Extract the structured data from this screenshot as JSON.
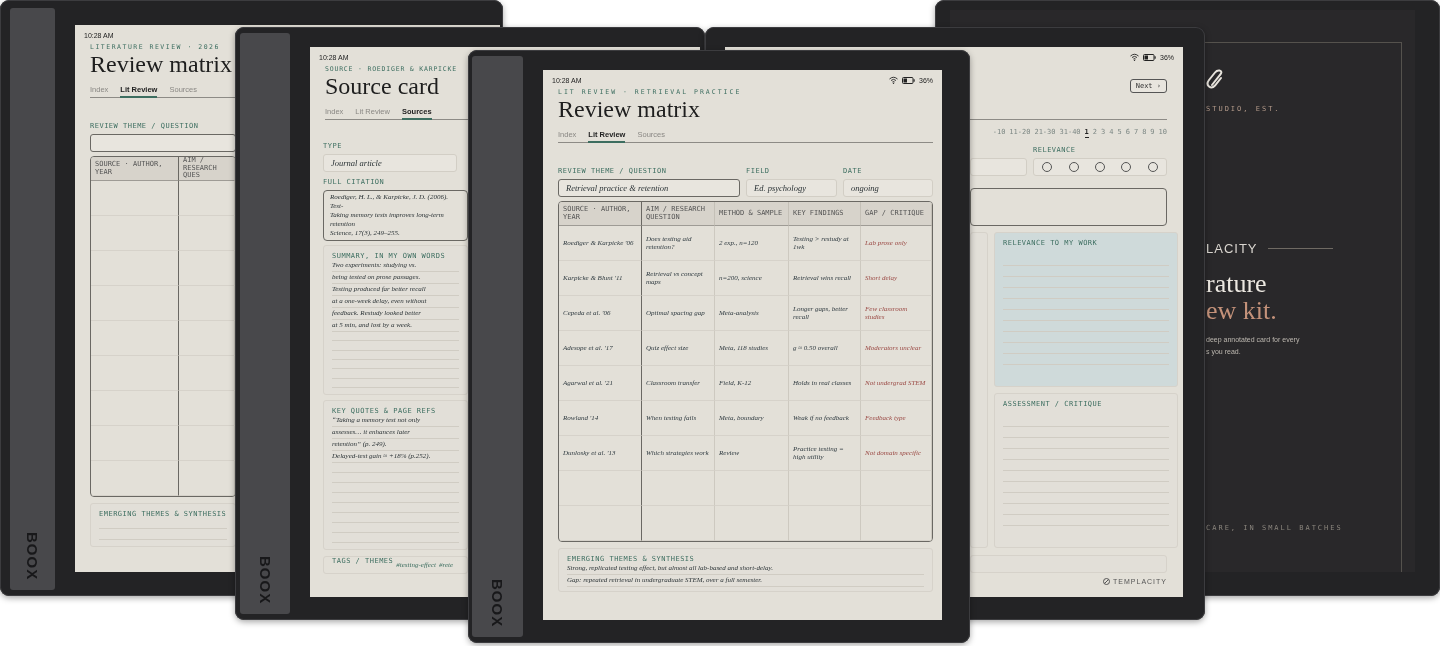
{
  "left_device": {
    "brand": "BOOX",
    "time": "10:28 AM",
    "eyebrow": "LITERATURE REVIEW · 2026",
    "title": "Review matrix",
    "tabs": [
      {
        "label": "Index",
        "selected": false
      },
      {
        "label": "Lit Review",
        "selected": true
      },
      {
        "label": "Sources",
        "selected": false
      }
    ],
    "theme_label": "REVIEW THEME / QUESTION",
    "columns": [
      "SOURCE · AUTHOR, YEAR",
      "AIM / RESEARCH QUES"
    ],
    "synthesis_label": "EMERGING THEMES & SYNTHESIS"
  },
  "source_device": {
    "brand": "BOOX",
    "time": "10:28 AM",
    "eyebrow": "SOURCE · ROEDIGER & KARPICKE",
    "title": "Source card",
    "tabs": [
      {
        "label": "Index",
        "selected": false
      },
      {
        "label": "Lit Review",
        "selected": false
      },
      {
        "label": "Sources",
        "selected": true
      }
    ],
    "type_label": "TYPE",
    "type_value": "Journal article",
    "citation_label": "FULL CITATION",
    "citation_lines": [
      "Roediger, H. L., & Karpicke, J. D. (2006). Test-",
      "Taking memory tests improves long-term retention",
      "Science, 17(3), 249–255."
    ],
    "summary": {
      "label": "SUMMARY, IN MY OWN WORDS",
      "lines": [
        "Two experiments: studying vs.",
        "being tested on prose passages.",
        "Testing produced far better recall",
        "at a one-week delay, even without",
        "feedback. Restudy looked better",
        "at 5 min, and lost by a week."
      ]
    },
    "quotes": {
      "label": "KEY QUOTES & PAGE REFS",
      "lines": [
        "“Taking a memory test not only",
        "assesses… it enhances later",
        "retention” (p. 249).",
        "Delayed-test gain ≈ +18% (p.252)."
      ]
    },
    "tags_label": "TAGS / THEMES",
    "tags": [
      "#testing-effect",
      "#rete"
    ]
  },
  "right_device": {
    "battery": "36%",
    "next_button": "Next ›",
    "pages": [
      {
        "label": "-10",
        "selected": false
      },
      {
        "label": "11-20",
        "selected": false
      },
      {
        "label": "21-30",
        "selected": false
      },
      {
        "label": "31-40",
        "selected": false
      },
      {
        "label": "1",
        "selected": true
      },
      {
        "label": "2",
        "selected": false
      },
      {
        "label": "3",
        "selected": false
      },
      {
        "label": "4",
        "selected": false
      },
      {
        "label": "5",
        "selected": false
      },
      {
        "label": "6",
        "selected": false
      },
      {
        "label": "7",
        "selected": false
      },
      {
        "label": "8",
        "selected": false
      },
      {
        "label": "9",
        "selected": false
      },
      {
        "label": "10",
        "selected": false
      }
    ],
    "relevance": {
      "label": "RELEVANCE",
      "stars": 0
    },
    "panels": [
      {
        "label": "RELEVANCE TO MY WORK",
        "highlighted": true
      },
      {
        "label": "ASSESSMENT / CRITIQUE",
        "highlighted": false
      }
    ],
    "footer": "TEMPLACITY"
  },
  "cover_device": {
    "studio": "STUDIO, EST.",
    "brand": "LACITY",
    "headline": "rature",
    "headline_accent": "ew kit.",
    "blurb_lines": [
      "deep annotated card for every",
      "s you read."
    ],
    "footer": "CARE, IN SMALL BATCHES"
  },
  "center_device": {
    "brand": "BOOX",
    "time": "10:28 AM",
    "battery": "36%",
    "eyebrow": "LIT REVIEW · RETRIEVAL PRACTICE",
    "title": "Review matrix",
    "tabs": [
      {
        "label": "Index",
        "selected": false
      },
      {
        "label": "Lit Review",
        "selected": true
      },
      {
        "label": "Sources",
        "selected": false
      }
    ],
    "fields": [
      {
        "label": "REVIEW THEME / QUESTION",
        "value": "Retrieval practice & retention"
      },
      {
        "label": "FIELD",
        "value": "Ed. psychology"
      },
      {
        "label": "DATE",
        "value": "ongoing"
      }
    ],
    "table": {
      "columns": [
        "SOURCE · AUTHOR, YEAR",
        "AIM / RESEARCH QUESTION",
        "METHOD & SAMPLE",
        "KEY FINDINGS",
        "GAP / CRITIQUE"
      ],
      "rows": [
        [
          "Roediger & Karpicke '06",
          "Does testing aid retention?",
          "2 exp., n=120",
          "Testing > restudy at 1wk",
          "Lab prose only"
        ],
        [
          "Karpicke & Blunt '11",
          "Retrieval vs concept maps",
          "n=200, science",
          "Retrieval wins recall",
          "Short delay"
        ],
        [
          "Cepeda et al. '06",
          "Optimal spacing gap",
          "Meta-analysis",
          "Longer gaps, better recall",
          "Few classroom studies"
        ],
        [
          "Adesope et al. '17",
          "Quiz effect size",
          "Meta, 118 studies",
          "g ≈ 0.50 overall",
          "Moderators unclear"
        ],
        [
          "Agarwal et al. '21",
          "Classroom transfer",
          "Field, K-12",
          "Holds in real classes",
          "Not undergrad STEM"
        ],
        [
          "Rowland '14",
          "When testing fails",
          "Meta, boundary",
          "Weak if no feedback",
          "Feedback type"
        ],
        [
          "Dunlosky et al. '13",
          "Which strategies work",
          "Review",
          "Practice testing = high utility",
          "Not domain specific"
        ]
      ]
    },
    "synthesis": {
      "label": "EMERGING THEMES & SYNTHESIS",
      "lines": [
        "Strong, replicated testing effect, but almost all lab-based and short-delay.",
        "Gap: repeated retrieval in undergraduate STEM, over a full semester."
      ]
    }
  }
}
